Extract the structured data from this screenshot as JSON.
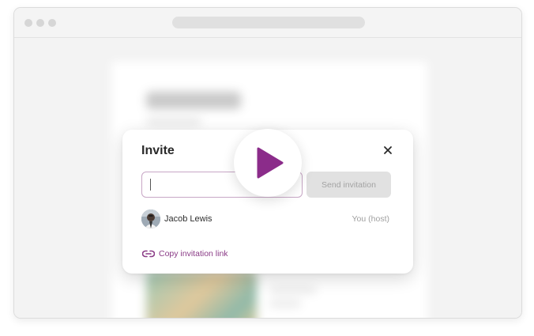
{
  "colors": {
    "accent": "#8b2c8a",
    "link": "#8a3b86",
    "input_border": "#c8a7c6",
    "send_button_bg": "#e1e1e1",
    "send_button_text": "#a3a3a3"
  },
  "modal": {
    "title": "Invite",
    "close_icon": "close-icon",
    "input": {
      "value": "",
      "placeholder": ""
    },
    "send_button_label": "Send invitation",
    "members": [
      {
        "name": "Jacob Lewis",
        "role": "You (host)",
        "avatar_icon": "user-avatar"
      }
    ],
    "copy_link": {
      "icon": "link-icon",
      "label": "Copy invitation link"
    }
  },
  "overlay": {
    "play_icon": "play-icon"
  }
}
